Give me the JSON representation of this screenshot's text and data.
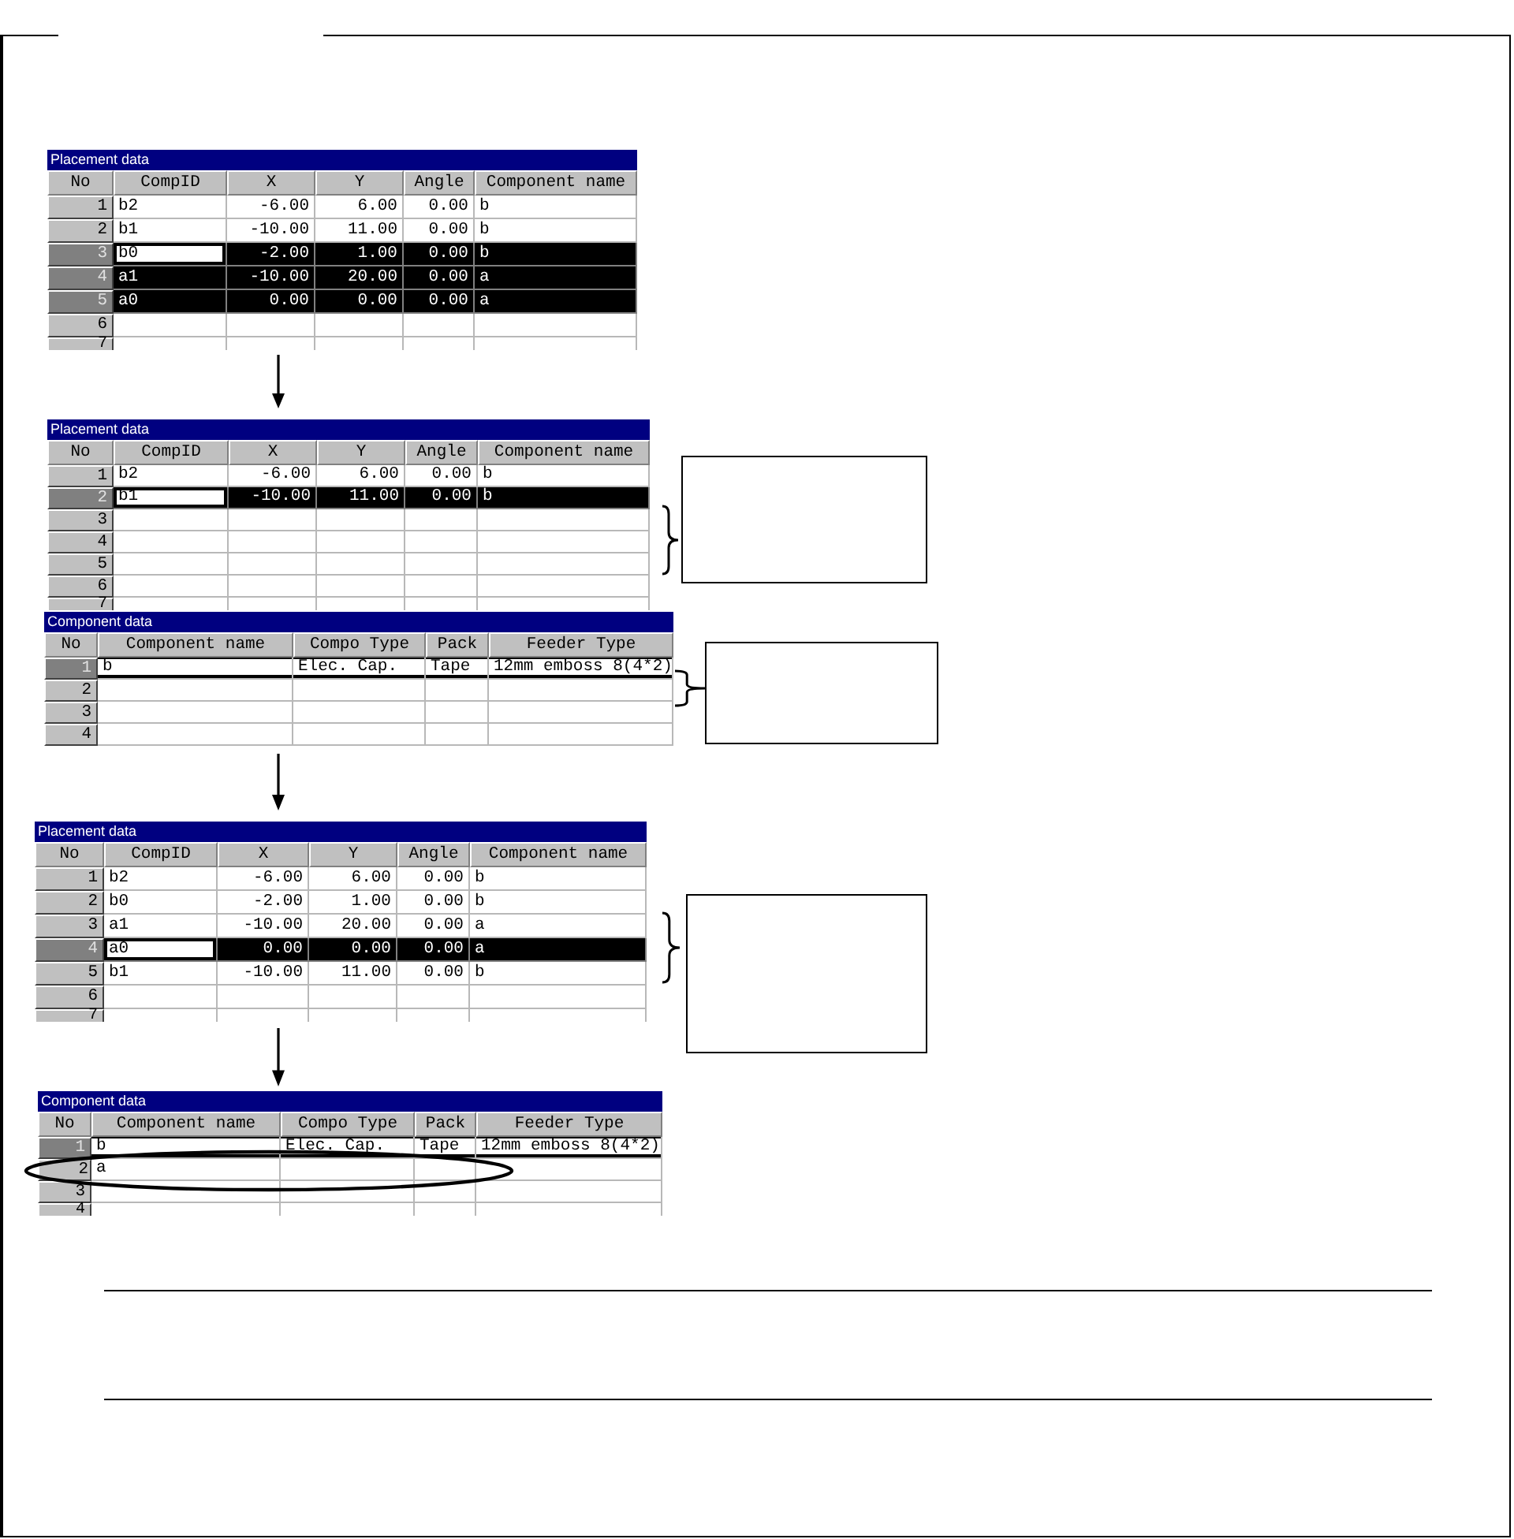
{
  "steps": [
    {
      "tables": [
        {
          "kind": "placement",
          "title": "Placement data",
          "columns": [
            "No",
            "CompID",
            "X",
            "Y",
            "Angle",
            "Component name"
          ],
          "rows": [
            {
              "no": "1",
              "cells": [
                "b2",
                "-6.00",
                "6.00",
                "0.00",
                "b"
              ],
              "selected": false,
              "current": false
            },
            {
              "no": "2",
              "cells": [
                "b1",
                "-10.00",
                "11.00",
                "0.00",
                "b"
              ],
              "selected": false,
              "current": false
            },
            {
              "no": "3",
              "cells": [
                "b0",
                "-2.00",
                "1.00",
                "0.00",
                "b"
              ],
              "selected": true,
              "current": true
            },
            {
              "no": "4",
              "cells": [
                "a1",
                "-10.00",
                "20.00",
                "0.00",
                "a"
              ],
              "selected": true,
              "current": false
            },
            {
              "no": "5",
              "cells": [
                "a0",
                "0.00",
                "0.00",
                "0.00",
                "a"
              ],
              "selected": true,
              "current": false
            },
            {
              "no": "6",
              "selected": false,
              "current": false
            },
            {
              "no": "7",
              "selected": false,
              "current": false
            }
          ]
        }
      ]
    },
    {
      "tables": [
        {
          "kind": "placement",
          "title": "Placement data",
          "columns": [
            "No",
            "CompID",
            "X",
            "Y",
            "Angle",
            "Component name"
          ],
          "callout": true,
          "rows": [
            {
              "no": "1",
              "cells": [
                "b2",
                "-6.00",
                "6.00",
                "0.00",
                "b"
              ],
              "selected": false,
              "current": false
            },
            {
              "no": "2",
              "cells": [
                "b1",
                "-10.00",
                "11.00",
                "0.00",
                "b"
              ],
              "selected": true,
              "current": true
            },
            {
              "no": "3",
              "selected": false,
              "current": false
            },
            {
              "no": "4",
              "selected": false,
              "current": false
            },
            {
              "no": "5",
              "selected": false,
              "current": false
            },
            {
              "no": "6",
              "selected": false,
              "current": false
            },
            {
              "no": "7",
              "selected": false,
              "current": false
            }
          ]
        },
        {
          "kind": "component",
          "title": "Component data",
          "columns": [
            "No",
            "Component name",
            "Compo Type",
            "Pack",
            "Feeder Type"
          ],
          "callout": true,
          "rows": [
            {
              "no": "1",
              "cells": [
                "b",
                "Elec. Cap.",
                "Tape",
                "12mm emboss 8(4*2)"
              ],
              "selected": false,
              "current": true
            },
            {
              "no": "2",
              "selected": false,
              "current": false
            },
            {
              "no": "3",
              "selected": false,
              "current": false
            },
            {
              "no": "4",
              "selected": false,
              "current": false
            }
          ]
        }
      ]
    },
    {
      "tables": [
        {
          "kind": "placement",
          "title": "Placement data",
          "columns": [
            "No",
            "CompID",
            "X",
            "Y",
            "Angle",
            "Component name"
          ],
          "callout": true,
          "rows": [
            {
              "no": "1",
              "cells": [
                "b2",
                "-6.00",
                "6.00",
                "0.00",
                "b"
              ],
              "selected": false,
              "current": false
            },
            {
              "no": "2",
              "cells": [
                "b0",
                "-2.00",
                "1.00",
                "0.00",
                "b"
              ],
              "selected": false,
              "current": false
            },
            {
              "no": "3",
              "cells": [
                "a1",
                "-10.00",
                "20.00",
                "0.00",
                "a"
              ],
              "selected": false,
              "current": false
            },
            {
              "no": "4",
              "cells": [
                "a0",
                "0.00",
                "0.00",
                "0.00",
                "a"
              ],
              "selected": true,
              "current": true
            },
            {
              "no": "5",
              "cells": [
                "b1",
                "-10.00",
                "11.00",
                "0.00",
                "b"
              ],
              "selected": false,
              "current": false
            },
            {
              "no": "6",
              "selected": false,
              "current": false
            },
            {
              "no": "7",
              "selected": false,
              "current": false
            }
          ]
        }
      ]
    },
    {
      "tables": [
        {
          "kind": "component",
          "title": "Component data",
          "columns": [
            "No",
            "Component name",
            "Compo Type",
            "Pack",
            "Feeder Type"
          ],
          "rows": [
            {
              "no": "1",
              "cells": [
                "b",
                "Elec. Cap.",
                "Tape",
                "12mm emboss 8(4*2)"
              ],
              "selected": false,
              "current": true
            },
            {
              "no": "2",
              "cells": [
                "a"
              ],
              "selected": false,
              "current": false,
              "circled": true
            },
            {
              "no": "3",
              "selected": false,
              "current": false
            },
            {
              "no": "4",
              "selected": false,
              "current": false
            }
          ]
        }
      ]
    }
  ]
}
